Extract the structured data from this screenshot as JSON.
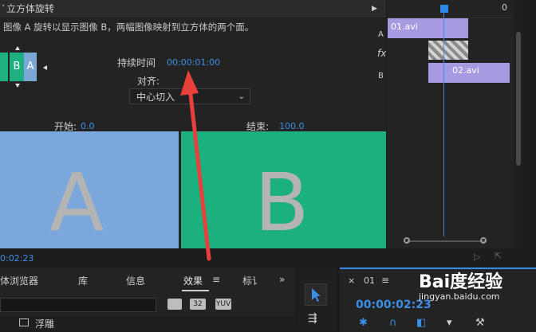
{
  "effect_controls": {
    "header_title": "立方体旋转",
    "description": "图像 A 旋转以显示图像 B，两幅图像映射到立方体的两个面。",
    "thumb_letter_b": "B",
    "thumb_letter_a": "A",
    "duration_label": "持续时间",
    "duration_value": "00:00:01:00",
    "align_label": "对齐:",
    "align_value": "中心切入",
    "start_label": "开始:",
    "start_value": "0.0",
    "end_label": "结束:",
    "end_value": "100.0",
    "preview_a_letter": "A",
    "preview_b_letter": "B",
    "time_readout": "0:02:23"
  },
  "mini_timeline": {
    "ruler_zero": "0",
    "track_a_label": "A",
    "track_fx_label": "fx",
    "track_b_label": "B",
    "clip_a_name": "01.avi",
    "clip_b_name": "02.avi"
  },
  "bottom_panel": {
    "tabs": [
      "体浏览器",
      "库",
      "信息",
      "效果",
      "标讠"
    ],
    "effects_menu": "≡",
    "overflow": "»",
    "badges": [
      "32",
      "YUV"
    ],
    "folder_label": "浮雕"
  },
  "sequence": {
    "close": "×",
    "name": "01",
    "menu": "≡",
    "timecode": "00:00:02:23"
  },
  "watermark": {
    "brand": "Bai度经验",
    "url": "jingyan.baidu.com"
  },
  "colors": {
    "accent_blue": "#3a8ee6",
    "clip_purple": "#a79ae2",
    "preview_blue": "#7ba7da",
    "preview_green": "#1cb07f",
    "arrow_red": "#e8413b"
  }
}
